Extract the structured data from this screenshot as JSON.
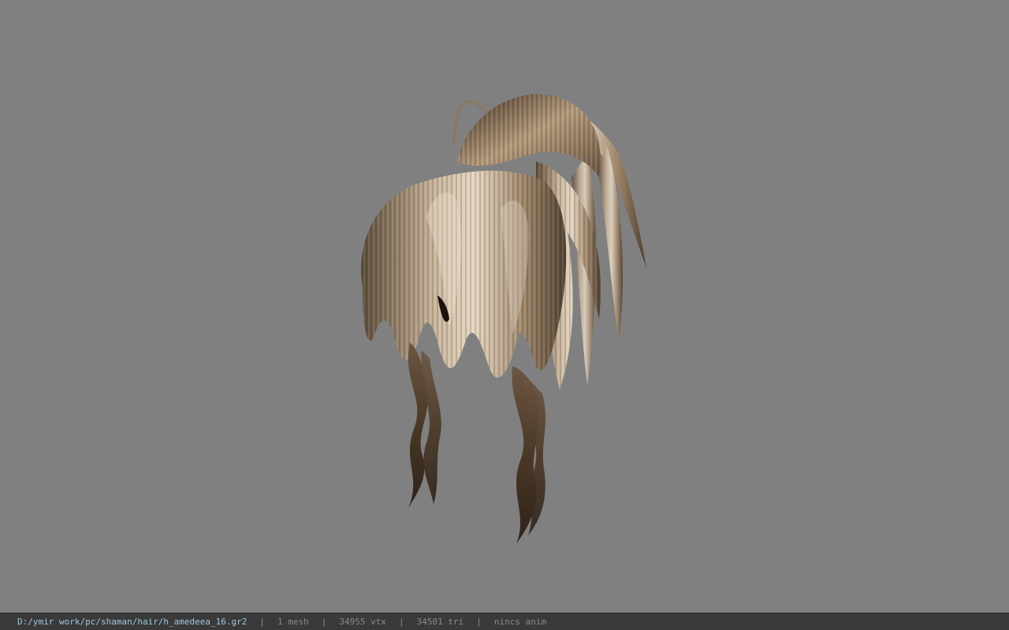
{
  "viewport": {
    "background_color": "#808080",
    "model_icon": "hair-mesh"
  },
  "status": {
    "file_path": "D:/ymir work/pc/shaman/hair/h_amedeea_16.gr2",
    "mesh_count": "1 mesh",
    "vertex_count": "34955 vtx",
    "triangle_count": "34501 tri",
    "animation": "nincs anim",
    "separator": "|"
  }
}
